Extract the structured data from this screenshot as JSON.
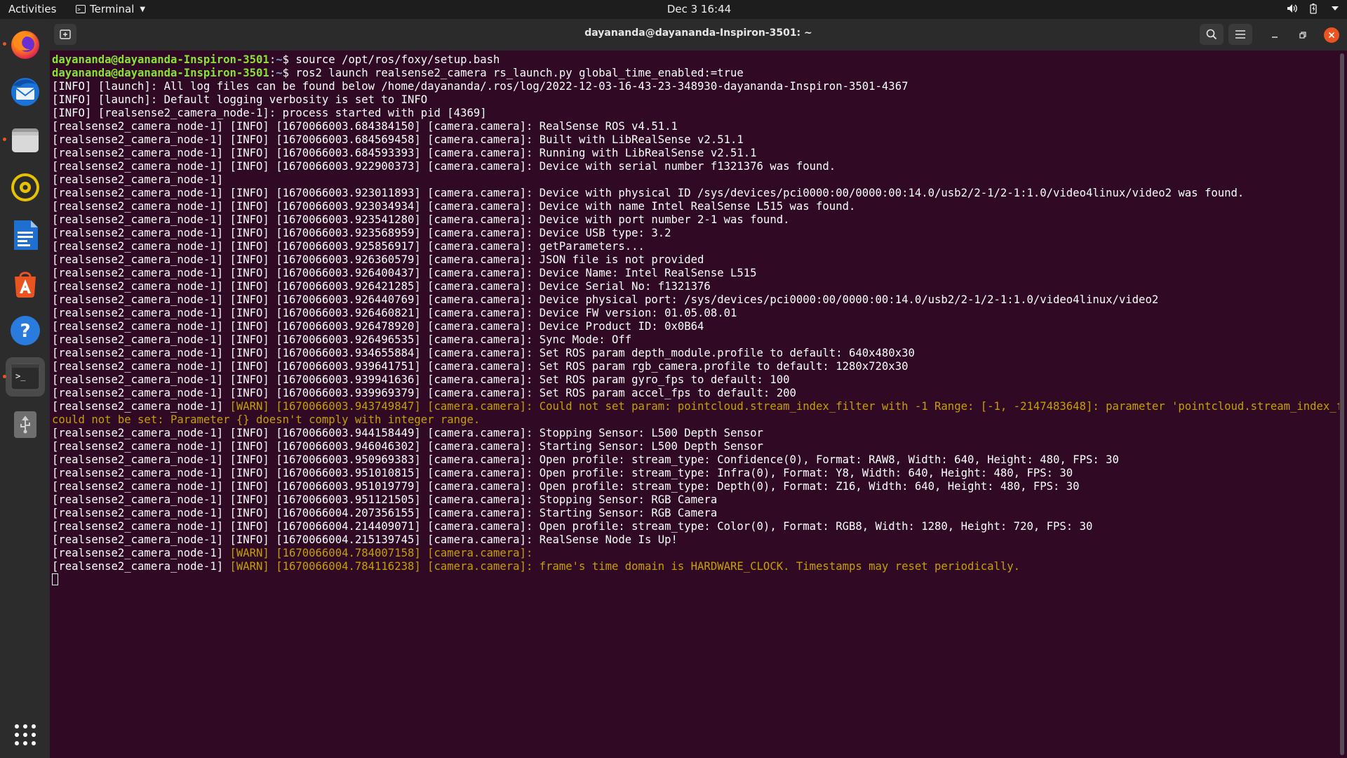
{
  "topbar": {
    "activities": "Activities",
    "app_name": "Terminal",
    "clock": "Dec 3  16:44"
  },
  "dock": {
    "items": [
      {
        "name": "firefox",
        "icon": "firefox-icon",
        "running": true
      },
      {
        "name": "thunderbird",
        "icon": "thunderbird-icon",
        "running": false
      },
      {
        "name": "files",
        "icon": "files-icon",
        "running": true
      },
      {
        "name": "rhythmbox",
        "icon": "rhythmbox-icon",
        "running": false
      },
      {
        "name": "libreoffice-writer",
        "icon": "writer-icon",
        "running": false
      },
      {
        "name": "ubuntu-software",
        "icon": "software-icon",
        "running": false
      },
      {
        "name": "help",
        "icon": "help-icon",
        "running": false
      },
      {
        "name": "terminal",
        "icon": "terminal-icon",
        "running": true,
        "active": true
      },
      {
        "name": "usb-drive",
        "icon": "usb-icon",
        "running": false
      }
    ],
    "show_apps_icon": "grid-icon"
  },
  "window": {
    "title": "dayananda@dayananda-Inspiron-3501: ~"
  },
  "colors": {
    "terminal_bg": "#300a24",
    "prompt_user": "#8ae234",
    "prompt_path": "#729fcf",
    "warn": "#c4a000",
    "accent": "#e95420"
  },
  "terminal": {
    "lines": [
      {
        "user": "dayananda@dayananda-Inspiron-3501",
        "path": "~",
        "cmd": "$ source /opt/ros/foxy/setup.bash"
      },
      {
        "user": "dayananda@dayananda-Inspiron-3501",
        "path": "~",
        "cmd": "$ ros2 launch realsense2_camera rs_launch.py global_time_enabled:=true"
      },
      {
        "text": "[INFO] [launch]: All log files can be found below /home/dayananda/.ros/log/2022-12-03-16-43-23-348930-dayananda-Inspiron-3501-4367"
      },
      {
        "text": "[INFO] [launch]: Default logging verbosity is set to INFO"
      },
      {
        "text": "[INFO] [realsense2_camera_node-1]: process started with pid [4369]"
      },
      {
        "text": "[realsense2_camera_node-1] [INFO] [1670066003.684384150] [camera.camera]: RealSense ROS v4.51.1"
      },
      {
        "text": "[realsense2_camera_node-1] [INFO] [1670066003.684569458] [camera.camera]: Built with LibRealSense v2.51.1"
      },
      {
        "text": "[realsense2_camera_node-1] [INFO] [1670066003.684593393] [camera.camera]: Running with LibRealSense v2.51.1"
      },
      {
        "text": "[realsense2_camera_node-1] [INFO] [1670066003.922900373] [camera.camera]: Device with serial number f1321376 was found."
      },
      {
        "text": "[realsense2_camera_node-1]"
      },
      {
        "text": "[realsense2_camera_node-1] [INFO] [1670066003.923011893] [camera.camera]: Device with physical ID /sys/devices/pci0000:00/0000:00:14.0/usb2/2-1/2-1:1.0/video4linux/video2 was found."
      },
      {
        "text": "[realsense2_camera_node-1] [INFO] [1670066003.923034934] [camera.camera]: Device with name Intel RealSense L515 was found."
      },
      {
        "text": "[realsense2_camera_node-1] [INFO] [1670066003.923541280] [camera.camera]: Device with port number 2-1 was found."
      },
      {
        "text": "[realsense2_camera_node-1] [INFO] [1670066003.923568959] [camera.camera]: Device USB type: 3.2"
      },
      {
        "text": "[realsense2_camera_node-1] [INFO] [1670066003.925856917] [camera.camera]: getParameters..."
      },
      {
        "text": "[realsense2_camera_node-1] [INFO] [1670066003.926360579] [camera.camera]: JSON file is not provided"
      },
      {
        "text": "[realsense2_camera_node-1] [INFO] [1670066003.926400437] [camera.camera]: Device Name: Intel RealSense L515"
      },
      {
        "text": "[realsense2_camera_node-1] [INFO] [1670066003.926421285] [camera.camera]: Device Serial No: f1321376"
      },
      {
        "text": "[realsense2_camera_node-1] [INFO] [1670066003.926440769] [camera.camera]: Device physical port: /sys/devices/pci0000:00/0000:00:14.0/usb2/2-1/2-1:1.0/video4linux/video2"
      },
      {
        "text": "[realsense2_camera_node-1] [INFO] [1670066003.926460821] [camera.camera]: Device FW version: 01.05.08.01"
      },
      {
        "text": "[realsense2_camera_node-1] [INFO] [1670066003.926478920] [camera.camera]: Device Product ID: 0x0B64"
      },
      {
        "text": "[realsense2_camera_node-1] [INFO] [1670066003.926496535] [camera.camera]: Sync Mode: Off"
      },
      {
        "text": "[realsense2_camera_node-1] [INFO] [1670066003.934655884] [camera.camera]: Set ROS param depth_module.profile to default: 640x480x30"
      },
      {
        "text": "[realsense2_camera_node-1] [INFO] [1670066003.939641751] [camera.camera]: Set ROS param rgb_camera.profile to default: 1280x720x30"
      },
      {
        "text": "[realsense2_camera_node-1] [INFO] [1670066003.939941636] [camera.camera]: Set ROS param gyro_fps to default: 100"
      },
      {
        "text": "[realsense2_camera_node-1] [INFO] [1670066003.939969379] [camera.camera]: Set ROS param accel_fps to default: 200"
      },
      {
        "prefix": "[realsense2_camera_node-1] ",
        "warn": "[WARN] [1670066003.943749847] [camera.camera]: Could not set param: pointcloud.stream_index_filter with -1 Range: [-1, -2147483648]: parameter 'pointcloud.stream_index_filter'"
      },
      {
        "warn_only": "could not be set: Parameter {} doesn't comply with integer range."
      },
      {
        "text": "[realsense2_camera_node-1] [INFO] [1670066003.944158449] [camera.camera]: Stopping Sensor: L500 Depth Sensor"
      },
      {
        "text": "[realsense2_camera_node-1] [INFO] [1670066003.946046302] [camera.camera]: Starting Sensor: L500 Depth Sensor"
      },
      {
        "text": "[realsense2_camera_node-1] [INFO] [1670066003.950969383] [camera.camera]: Open profile: stream_type: Confidence(0), Format: RAW8, Width: 640, Height: 480, FPS: 30"
      },
      {
        "text": "[realsense2_camera_node-1] [INFO] [1670066003.951010815] [camera.camera]: Open profile: stream_type: Infra(0), Format: Y8, Width: 640, Height: 480, FPS: 30"
      },
      {
        "text": "[realsense2_camera_node-1] [INFO] [1670066003.951019779] [camera.camera]: Open profile: stream_type: Depth(0), Format: Z16, Width: 640, Height: 480, FPS: 30"
      },
      {
        "text": "[realsense2_camera_node-1] [INFO] [1670066003.951121505] [camera.camera]: Stopping Sensor: RGB Camera"
      },
      {
        "text": "[realsense2_camera_node-1] [INFO] [1670066004.207356155] [camera.camera]: Starting Sensor: RGB Camera"
      },
      {
        "text": "[realsense2_camera_node-1] [INFO] [1670066004.214409071] [camera.camera]: Open profile: stream_type: Color(0), Format: RGB8, Width: 1280, Height: 720, FPS: 30"
      },
      {
        "text": "[realsense2_camera_node-1] [INFO] [1670066004.215139745] [camera.camera]: RealSense Node Is Up!"
      },
      {
        "prefix": "[realsense2_camera_node-1] ",
        "warn": "[WARN] [1670066004.784007158] [camera.camera]:"
      },
      {
        "prefix": "[realsense2_camera_node-1] ",
        "warn": "[WARN] [1670066004.784116238] [camera.camera]: frame's time domain is HARDWARE_CLOCK. Timestamps may reset periodically."
      }
    ]
  }
}
